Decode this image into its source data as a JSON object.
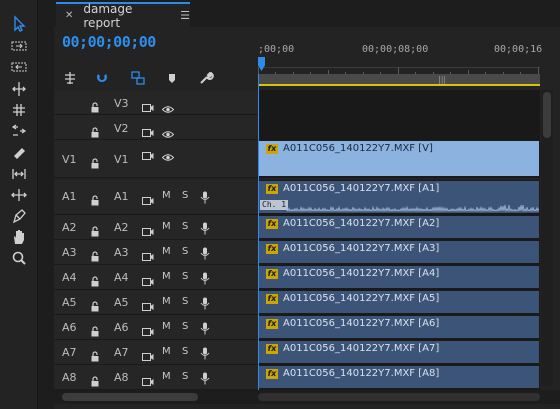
{
  "sequence": {
    "tab_label": "damage report",
    "timecode": "00;00;00;00",
    "ruler_labels": [
      ";00;00",
      "00;00;08;00",
      "00;00;16"
    ]
  },
  "video_tracks": [
    {
      "src": "",
      "dst": "V3",
      "clip": null
    },
    {
      "src": "",
      "dst": "V2",
      "clip": null
    },
    {
      "src": "V1",
      "dst": "V1",
      "clip": "A011C056_140122Y7.MXF [V]"
    }
  ],
  "audio_tracks": [
    {
      "src": "A1",
      "dst": "A1",
      "m": "M",
      "s": "S",
      "clip": "A011C056_140122Y7.MXF [A1]",
      "channel": "Ch. 1"
    },
    {
      "src": "A2",
      "dst": "A2",
      "m": "M",
      "s": "S",
      "clip": "A011C056_140122Y7.MXF [A2]"
    },
    {
      "src": "A3",
      "dst": "A3",
      "m": "M",
      "s": "S",
      "clip": "A011C056_140122Y7.MXF [A3]"
    },
    {
      "src": "A4",
      "dst": "A4",
      "m": "M",
      "s": "S",
      "clip": "A011C056_140122Y7.MXF [A4]"
    },
    {
      "src": "A5",
      "dst": "A5",
      "m": "M",
      "s": "S",
      "clip": "A011C056_140122Y7.MXF [A5]"
    },
    {
      "src": "A6",
      "dst": "A6",
      "m": "M",
      "s": "S",
      "clip": "A011C056_140122Y7.MXF [A6]"
    },
    {
      "src": "A7",
      "dst": "A7",
      "m": "M",
      "s": "S",
      "clip": "A011C056_140122Y7.MXF [A7]"
    },
    {
      "src": "A8",
      "dst": "A8",
      "m": "M",
      "s": "S",
      "clip": "A011C056_140122Y7.MXF [A8]"
    }
  ],
  "tools": [
    "selection-tool",
    "track-select-forward-tool",
    "track-select-backward-tool",
    "ripple-edit-tool",
    "rolling-edit-tool",
    "rate-stretch-tool",
    "razor-tool",
    "slip-tool",
    "slide-tool",
    "pen-tool",
    "hand-tool",
    "zoom-tool"
  ],
  "fx_badge": "fx",
  "colors": {
    "accent": "#2d8ceb",
    "video_clip": "#8cb2e0",
    "audio_clip": "#3c5478",
    "work_area": "#d8c20a"
  }
}
